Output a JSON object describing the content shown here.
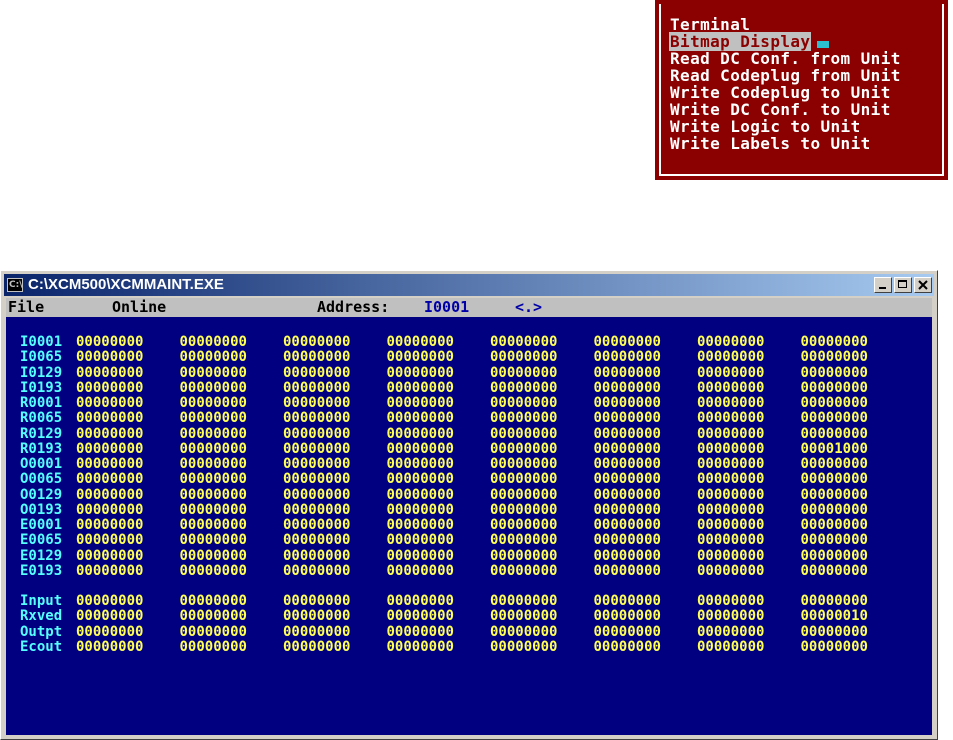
{
  "popup_menu": {
    "items": [
      "Terminal",
      "Bitmap Display",
      "Read DC Conf. from Unit",
      "Read Codeplug from Unit",
      "Write Codeplug to Unit",
      "Write DC Conf. to Unit",
      "Write Logic to Unit",
      "Write Labels to Unit"
    ],
    "selected_index": 1
  },
  "window": {
    "title": "C:\\XCM500\\XCMMAINT.EXE",
    "icon_text": "C:\\"
  },
  "menubar": {
    "file": "File",
    "online": "Online",
    "address_label": "Address:",
    "address_value": "I0001",
    "nav_hint": "<.>"
  },
  "registers": [
    {
      "label": "I0001",
      "values": [
        "00000000",
        "00000000",
        "00000000",
        "00000000",
        "00000000",
        "00000000",
        "00000000",
        "00000000"
      ]
    },
    {
      "label": "I0065",
      "values": [
        "00000000",
        "00000000",
        "00000000",
        "00000000",
        "00000000",
        "00000000",
        "00000000",
        "00000000"
      ]
    },
    {
      "label": "I0129",
      "values": [
        "00000000",
        "00000000",
        "00000000",
        "00000000",
        "00000000",
        "00000000",
        "00000000",
        "00000000"
      ]
    },
    {
      "label": "I0193",
      "values": [
        "00000000",
        "00000000",
        "00000000",
        "00000000",
        "00000000",
        "00000000",
        "00000000",
        "00000000"
      ]
    },
    {
      "label": "R0001",
      "values": [
        "00000000",
        "00000000",
        "00000000",
        "00000000",
        "00000000",
        "00000000",
        "00000000",
        "00000000"
      ]
    },
    {
      "label": "R0065",
      "values": [
        "00000000",
        "00000000",
        "00000000",
        "00000000",
        "00000000",
        "00000000",
        "00000000",
        "00000000"
      ]
    },
    {
      "label": "R0129",
      "values": [
        "00000000",
        "00000000",
        "00000000",
        "00000000",
        "00000000",
        "00000000",
        "00000000",
        "00000000"
      ]
    },
    {
      "label": "R0193",
      "values": [
        "00000000",
        "00000000",
        "00000000",
        "00000000",
        "00000000",
        "00000000",
        "00000000",
        "00001000"
      ]
    },
    {
      "label": "O0001",
      "values": [
        "00000000",
        "00000000",
        "00000000",
        "00000000",
        "00000000",
        "00000000",
        "00000000",
        "00000000"
      ]
    },
    {
      "label": "O0065",
      "values": [
        "00000000",
        "00000000",
        "00000000",
        "00000000",
        "00000000",
        "00000000",
        "00000000",
        "00000000"
      ]
    },
    {
      "label": "O0129",
      "values": [
        "00000000",
        "00000000",
        "00000000",
        "00000000",
        "00000000",
        "00000000",
        "00000000",
        "00000000"
      ]
    },
    {
      "label": "O0193",
      "values": [
        "00000000",
        "00000000",
        "00000000",
        "00000000",
        "00000000",
        "00000000",
        "00000000",
        "00000000"
      ]
    },
    {
      "label": "E0001",
      "values": [
        "00000000",
        "00000000",
        "00000000",
        "00000000",
        "00000000",
        "00000000",
        "00000000",
        "00000000"
      ]
    },
    {
      "label": "E0065",
      "values": [
        "00000000",
        "00000000",
        "00000000",
        "00000000",
        "00000000",
        "00000000",
        "00000000",
        "00000000"
      ]
    },
    {
      "label": "E0129",
      "values": [
        "00000000",
        "00000000",
        "00000000",
        "00000000",
        "00000000",
        "00000000",
        "00000000",
        "00000000"
      ]
    },
    {
      "label": "E0193",
      "values": [
        "00000000",
        "00000000",
        "00000000",
        "00000000",
        "00000000",
        "00000000",
        "00000000",
        "00000000"
      ]
    }
  ],
  "counters": [
    {
      "label": "Input",
      "values": [
        "00000000",
        "00000000",
        "00000000",
        "00000000",
        "00000000",
        "00000000",
        "00000000",
        "00000000"
      ]
    },
    {
      "label": "Rxved",
      "values": [
        "00000000",
        "00000000",
        "00000000",
        "00000000",
        "00000000",
        "00000000",
        "00000000",
        "00000010"
      ]
    },
    {
      "label": "Outpt",
      "values": [
        "00000000",
        "00000000",
        "00000000",
        "00000000",
        "00000000",
        "00000000",
        "00000000",
        "00000000"
      ]
    },
    {
      "label": "Ecout",
      "values": [
        "00000000",
        "00000000",
        "00000000",
        "00000000",
        "00000000",
        "00000000",
        "00000000",
        "00000000"
      ]
    }
  ],
  "colors": {
    "menu_bg": "#8b0000",
    "console_bg": "#000080",
    "label_color": "#55ffff",
    "value_color": "#ffff55"
  }
}
